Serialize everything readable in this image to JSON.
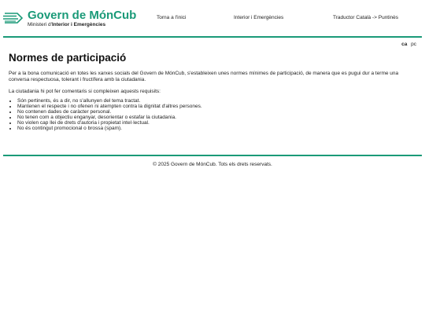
{
  "header": {
    "brand_title": "Govern de MónCub",
    "brand_sub_prefix": "Ministeri d'",
    "brand_sub_bold": "Interior i Emergències",
    "nav": [
      {
        "label": "Torna a l'inici"
      },
      {
        "label": "Interior i Emergències"
      },
      {
        "label": "Traductor Català -> Puntinès"
      }
    ]
  },
  "lang": {
    "active": "ca",
    "other": "pc"
  },
  "main": {
    "title": "Normes de participació",
    "intro": "Per a la bona comunicació en totes les xarxes socials del Govern de MónCub, s'estableixen unes normes mínimes de participació, de manera que es pugui dur a terme una conversa respectuosa, tolerant i fructífera amb la ciutadania.",
    "criteria_intro": "La ciutadania hi pot fer comentaris si compleixen aquests requisits:",
    "requirements": [
      "Són pertinents, és a dir, no s'allunyen del tema tractat.",
      "Mantenen el respecte i no ofenen ni atempten contra la dignitat d'altres persones.",
      "No contenen dades de caràcter personal.",
      "No tenen com a objectiu enganyar, desorientar o estafar la ciutadania.",
      "No violen cap llei de drets d'autoria i propietat intel·lectual.",
      "No és contingut promocional o brossa (spam)."
    ]
  },
  "footer": {
    "text": "© 2025 Govern de MónCub. Tots els drets reservats."
  },
  "colors": {
    "brand": "#1a9a78"
  }
}
